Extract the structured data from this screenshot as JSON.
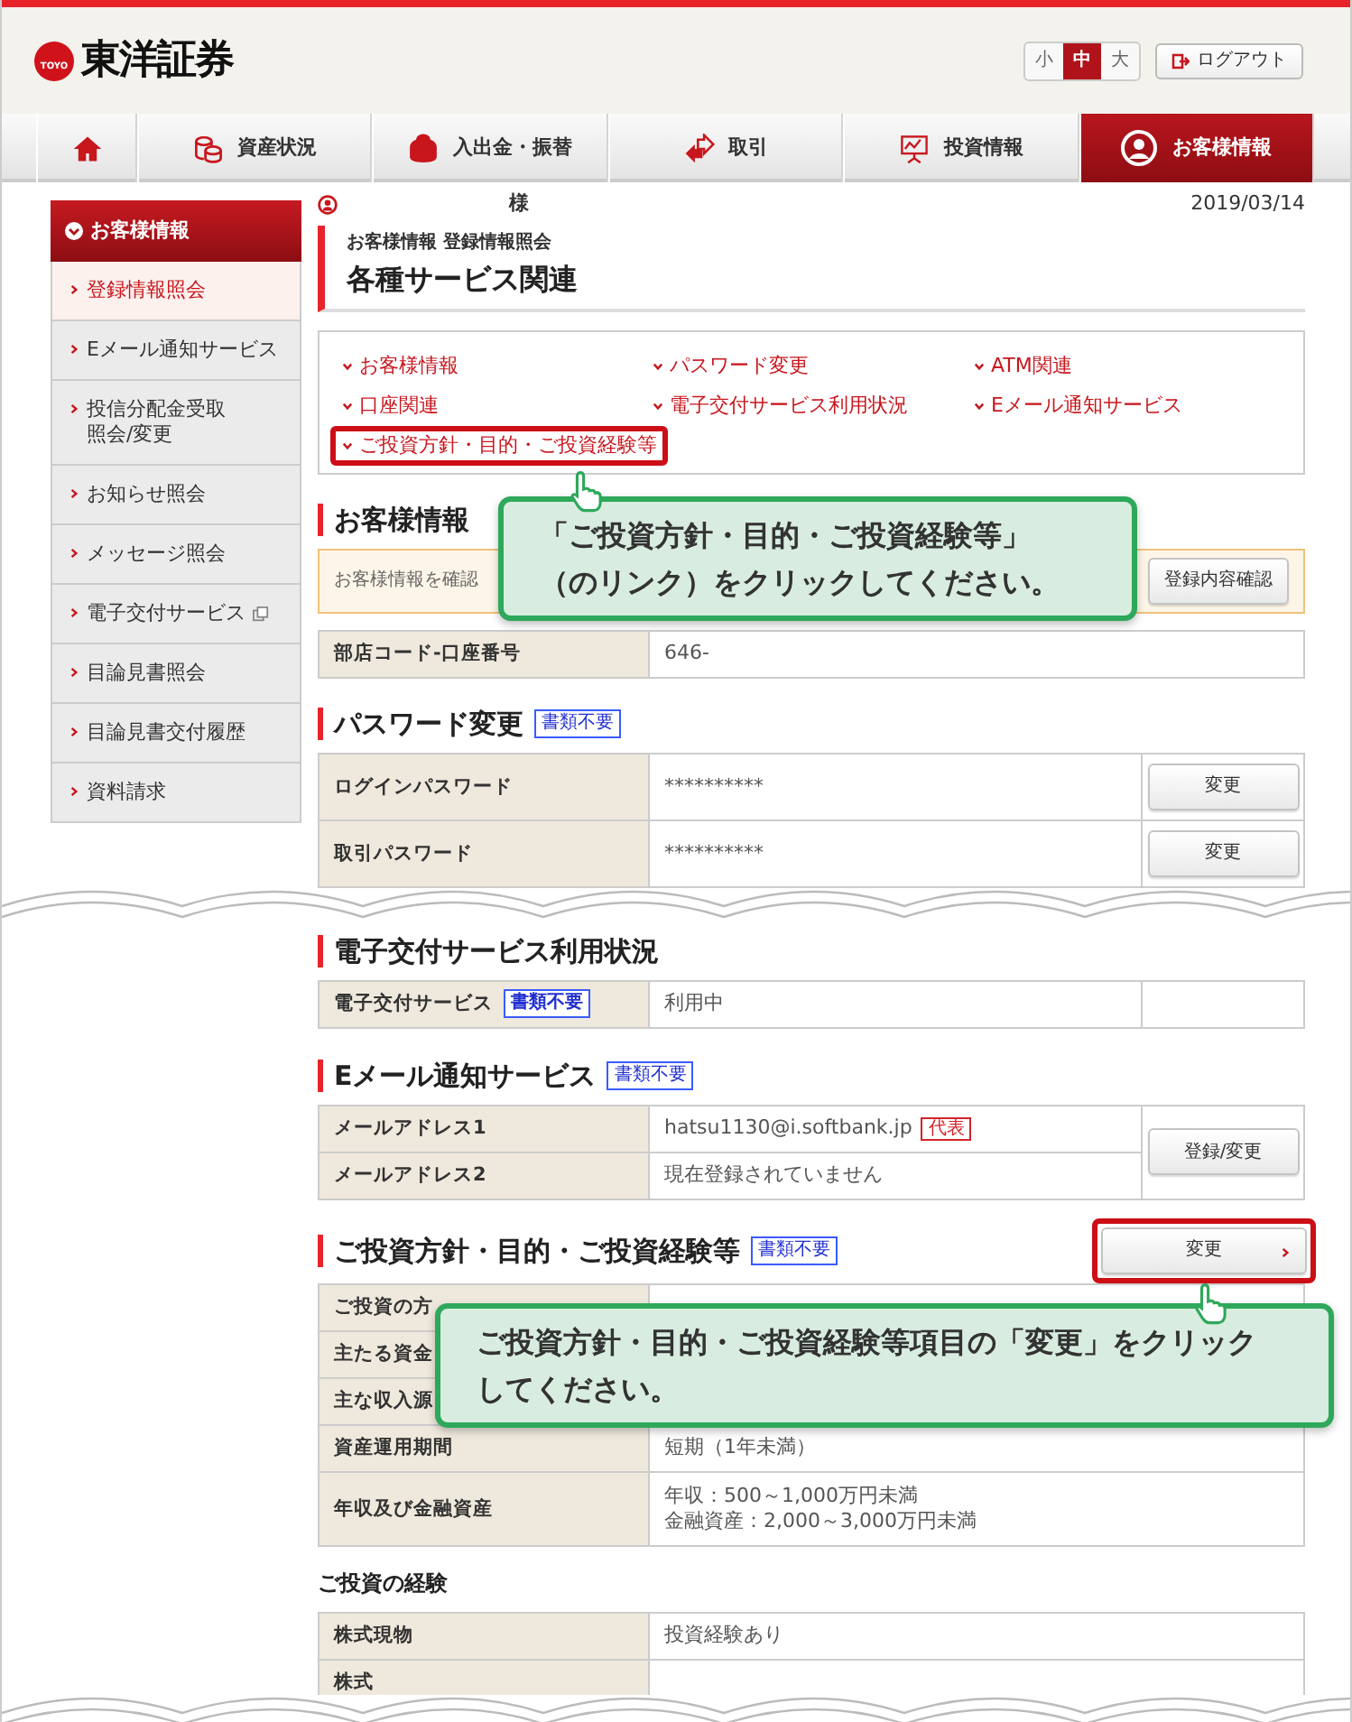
{
  "header": {
    "logo": "東洋証券",
    "logo_mark": "TOYO",
    "font_sizes": [
      {
        "label": "小",
        "selected": false
      },
      {
        "label": "中",
        "selected": true
      },
      {
        "label": "大",
        "selected": false
      }
    ],
    "logout": "ログアウト"
  },
  "nav": [
    {
      "selected": false
    },
    {
      "label": "資産状況",
      "selected": false
    },
    {
      "label": "入出金・振替",
      "selected": false
    },
    {
      "label": "取引",
      "selected": false
    },
    {
      "label": "投資情報",
      "selected": false
    },
    {
      "label": "お客様情報",
      "selected": true
    }
  ],
  "sidebar": {
    "title": "お客様情報",
    "items": [
      {
        "label": "登録情報照会",
        "selected": true
      },
      {
        "label": "Eメール通知サービス",
        "selected": false
      },
      {
        "label": "投信分配金受取照会/変更",
        "selected": false
      },
      {
        "label": "お知らせ照会",
        "selected": false
      },
      {
        "label": "メッセージ照会",
        "selected": false
      },
      {
        "label": "電子交付サービス",
        "selected": false,
        "external": true
      },
      {
        "label": "目論見書照会",
        "selected": false
      },
      {
        "label": "目論見書交付履歴",
        "selected": false
      },
      {
        "label": "資料請求",
        "selected": false
      }
    ]
  },
  "user": {
    "honorific": "様"
  },
  "date": "2019/03/14",
  "breadcrumb": "お客様情報 登録情報照会",
  "page_title": "各種サービス関連",
  "links": [
    {
      "label": "お客様情報",
      "highlighted": false
    },
    {
      "label": "パスワード変更",
      "highlighted": false
    },
    {
      "label": "ATM関連",
      "highlighted": false
    },
    {
      "label": "口座関連",
      "highlighted": false
    },
    {
      "label": "電子交付サービス利用状況",
      "highlighted": false
    },
    {
      "label": "Eメール通知サービス",
      "highlighted": false
    },
    {
      "label": "ご投資方針・目的・ご投資経験等",
      "highlighted": true
    }
  ],
  "sections": [
    {
      "kind": "section",
      "title": "お客様情報",
      "notice": {
        "text": "お客様情報を確認",
        "button": "登録内容確認"
      },
      "rows": [
        {
          "label": "部店コード-口座番号",
          "value": "646-"
        }
      ]
    },
    {
      "kind": "section",
      "title": "パスワード変更",
      "tag": "書類不要",
      "rows": [
        {
          "label": "ログインパスワード",
          "value": "**********",
          "button": "変更"
        },
        {
          "label": "取引パスワード",
          "value": "**********",
          "button": "変更"
        }
      ]
    },
    {
      "kind": "tear"
    },
    {
      "kind": "section",
      "title": "電子交付サービス利用状況",
      "side_column": true,
      "rows": [
        {
          "label": "電子交付サービス",
          "tag": "書類不要",
          "value": "利用中"
        }
      ]
    },
    {
      "kind": "section",
      "title": "Eメール通知サービス",
      "tag": "書類不要",
      "side_button": "登録/変更",
      "rows": [
        {
          "label": "メールアドレス1",
          "value": "hatsu1130@i.softbank.jp",
          "badge": "代表"
        },
        {
          "label": "メールアドレス2",
          "value": "現在登録されていません"
        }
      ]
    },
    {
      "kind": "section",
      "title": "ご投資方針・目的・ご投資経験等",
      "tag": "書類不要",
      "header_button": {
        "label": "変更",
        "highlighted": true
      },
      "rows": [
        {
          "label": "ご投資の方"
        },
        {
          "label": "主たる資金"
        },
        {
          "label": "主な収入源"
        },
        {
          "label": "資産運用期間",
          "value": "短期（1年未満）"
        },
        {
          "label": "年収及び金融資産",
          "value_lines": [
            "年収：500～1,000万円未満",
            "金融資産：2,000～3,000万円未満"
          ]
        }
      ]
    },
    {
      "kind": "subsection",
      "title": "ご投資の経験",
      "rows": [
        {
          "label": "株式現物",
          "value": "投資経験あり"
        },
        {
          "label": "株式"
        }
      ]
    }
  ],
  "callouts": [
    {
      "lines": [
        "「ご投資方針・目的・ご投資経験等」",
        "（のリンク）をクリックしてください。"
      ]
    },
    {
      "lines": [
        "ご投資方針・目的・ご投資経験等項目の「変更」をクリック",
        "してください。"
      ]
    }
  ]
}
